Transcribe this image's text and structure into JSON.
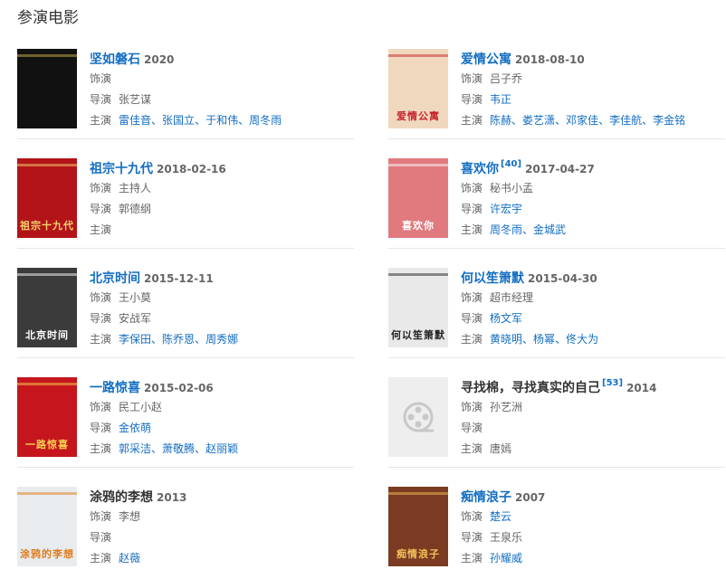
{
  "section_title": "参演电影",
  "labels": {
    "role": "饰演",
    "director": "导演",
    "cast": "主演"
  },
  "films": [
    {
      "title": "坚如磐石",
      "title_link": true,
      "ref": "",
      "date": "2020",
      "role": "",
      "role_link": false,
      "director": "张艺谋",
      "director_link": false,
      "cast": [
        "雷佳音",
        "张国立",
        "于和伟",
        "周冬雨"
      ],
      "cast_link": true,
      "poster_text": "",
      "poster_bg": "#111111",
      "poster_fg": "#d4b14a"
    },
    {
      "title": "爱情公寓",
      "title_link": true,
      "ref": "",
      "date": "2018-08-10",
      "role": "吕子乔",
      "role_link": false,
      "director": "韦正",
      "director_link": true,
      "cast": [
        "陈赫",
        "娄艺潇",
        "邓家佳",
        "李佳航",
        "李金铭"
      ],
      "cast_link": true,
      "poster_text": "爱情公寓",
      "poster_bg": "#f0d8bf",
      "poster_fg": "#c8202a"
    },
    {
      "title": "祖宗十九代",
      "title_link": true,
      "ref": "",
      "date": "2018-02-16",
      "role": "主持人",
      "role_link": false,
      "director": "郭德纲",
      "director_link": false,
      "cast": [],
      "cast_link": true,
      "poster_text": "祖宗十九代",
      "poster_bg": "#b3141a",
      "poster_fg": "#f3d36b"
    },
    {
      "title": "喜欢你",
      "title_link": true,
      "ref": "[40]",
      "date": "2017-04-27",
      "role": "秘书小孟",
      "role_link": false,
      "director": "许宏宇",
      "director_link": true,
      "cast": [
        "周冬雨",
        "金城武"
      ],
      "cast_link": true,
      "poster_text": "喜欢你",
      "poster_bg": "#e07a7e",
      "poster_fg": "#ffffff"
    },
    {
      "title": "北京时间",
      "title_link": true,
      "ref": "",
      "date": "2015-12-11",
      "role": "王小莫",
      "role_link": false,
      "director": "安战军",
      "director_link": false,
      "cast": [
        "李保田",
        "陈乔恩",
        "周秀娜"
      ],
      "cast_link": true,
      "poster_text": "北京时间",
      "poster_bg": "#3b3b3b",
      "poster_fg": "#ffffff"
    },
    {
      "title": "何以笙箫默",
      "title_link": true,
      "ref": "",
      "date": "2015-04-30",
      "role": "超市经理",
      "role_link": false,
      "director": "杨文军",
      "director_link": true,
      "cast": [
        "黄晓明",
        "杨幂",
        "佟大为"
      ],
      "cast_link": true,
      "poster_text": "何以笙箫默",
      "poster_bg": "#e9e9e9",
      "poster_fg": "#222222"
    },
    {
      "title": "一路惊喜",
      "title_link": true,
      "ref": "",
      "date": "2015-02-06",
      "role": "民工小赵",
      "role_link": false,
      "director": "金依萌",
      "director_link": true,
      "cast": [
        "郭采洁",
        "萧敬腾",
        "赵丽颖"
      ],
      "cast_link": true,
      "poster_text": "一路惊喜",
      "poster_bg": "#c5161d",
      "poster_fg": "#f6d34f"
    },
    {
      "title": "寻找棉，寻找真实的自己",
      "title_link": false,
      "ref": "[53]",
      "date": "2014",
      "role": "孙艺洲",
      "role_link": false,
      "director": "",
      "director_link": false,
      "cast": [
        "唐嫣"
      ],
      "cast_link": false,
      "poster_text": "",
      "poster_bg": "#eeeeee",
      "poster_fg": "#cccccc",
      "placeholder": true
    },
    {
      "title": "涂鸦的李想",
      "title_link": false,
      "ref": "",
      "date": "2013",
      "role": "李想",
      "role_link": false,
      "director": "",
      "director_link": false,
      "cast": [
        "赵薇"
      ],
      "cast_link": true,
      "poster_text": "涂鸦的李想",
      "poster_bg": "#e8ecef",
      "poster_fg": "#e07b1a"
    },
    {
      "title": "痴情浪子",
      "title_link": true,
      "ref": "",
      "date": "2007",
      "role": "楚云",
      "role_link": true,
      "director": "王泉乐",
      "director_link": false,
      "cast": [
        "孙耀威"
      ],
      "cast_link": true,
      "poster_text": "痴情浪子",
      "poster_bg": "#7a3b22",
      "poster_fg": "#f1c15a"
    }
  ]
}
